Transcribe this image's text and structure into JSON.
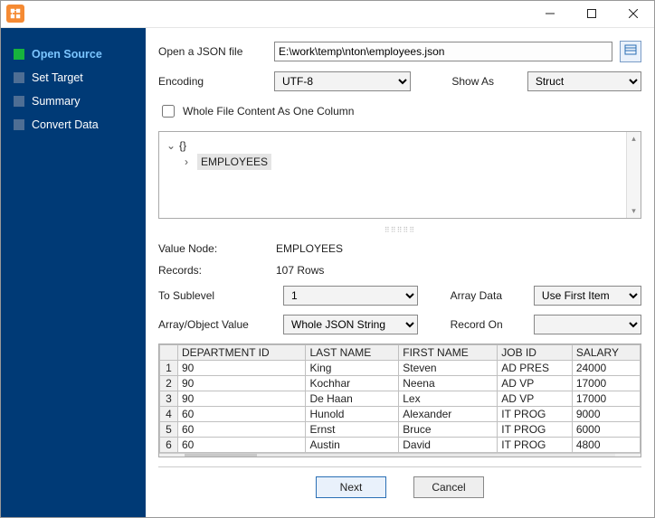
{
  "titlebar": {
    "title": ""
  },
  "sidebar": {
    "steps": [
      {
        "label": "Open Source",
        "active": true
      },
      {
        "label": "Set Target",
        "active": false
      },
      {
        "label": "Summary",
        "active": false
      },
      {
        "label": "Convert Data",
        "active": false
      }
    ]
  },
  "form": {
    "open_label": "Open a JSON file",
    "filepath": "E:\\work\\temp\\nton\\employees.json",
    "encoding_label": "Encoding",
    "encoding_value": "UTF-8",
    "show_as_label": "Show As",
    "show_as_value": "Struct",
    "whole_file_label": "Whole File Content As One Column",
    "whole_file_checked": false,
    "tree": {
      "root": "{}",
      "child": "EMPLOYEES"
    },
    "value_node_label": "Value Node:",
    "value_node": "EMPLOYEES",
    "records_label": "Records:",
    "records": "107 Rows",
    "to_sublevel_label": "To Sublevel",
    "to_sublevel_value": "1",
    "array_data_label": "Array Data",
    "array_data_value": "Use First Item",
    "array_object_label": "Array/Object Value",
    "array_object_value": "Whole JSON String",
    "record_on_label": "Record On",
    "record_on_value": ""
  },
  "table": {
    "columns": [
      "DEPARTMENT ID",
      "LAST NAME",
      "FIRST NAME",
      "JOB ID",
      "SALARY"
    ],
    "rows": [
      {
        "n": "1",
        "c": [
          "90",
          "King",
          "Steven",
          "AD PRES",
          "24000"
        ]
      },
      {
        "n": "2",
        "c": [
          "90",
          "Kochhar",
          "Neena",
          "AD VP",
          "17000"
        ]
      },
      {
        "n": "3",
        "c": [
          "90",
          "De Haan",
          "Lex",
          "AD VP",
          "17000"
        ]
      },
      {
        "n": "4",
        "c": [
          "60",
          "Hunold",
          "Alexander",
          "IT PROG",
          "9000"
        ]
      },
      {
        "n": "5",
        "c": [
          "60",
          "Ernst",
          "Bruce",
          "IT PROG",
          "6000"
        ]
      },
      {
        "n": "6",
        "c": [
          "60",
          "Austin",
          "David",
          "IT PROG",
          "4800"
        ]
      }
    ]
  },
  "footer": {
    "next": "Next",
    "cancel": "Cancel"
  }
}
